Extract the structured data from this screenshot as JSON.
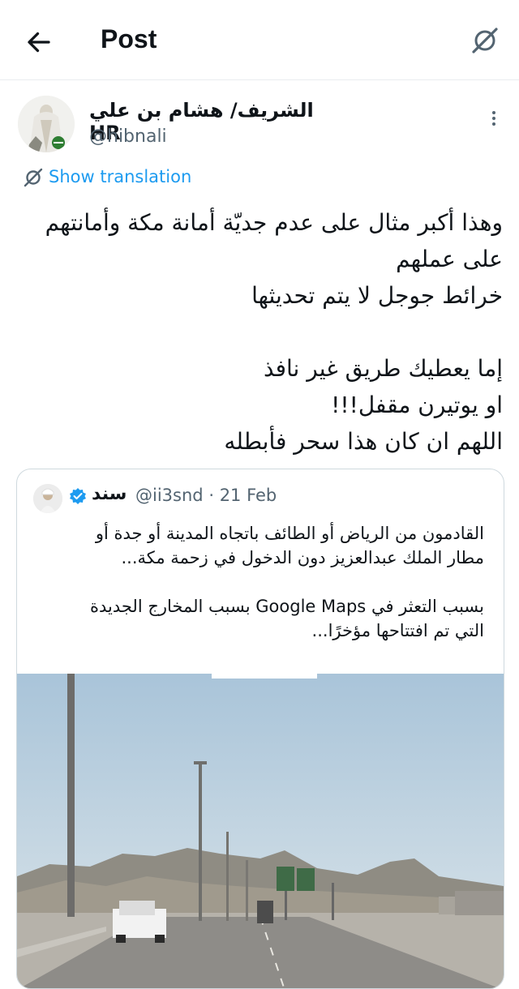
{
  "header": {
    "title": "Post",
    "back_icon": "arrow-left-icon",
    "grok_icon": "grok-icon"
  },
  "author": {
    "name": "الشريف/ هشام بن علي HR",
    "handle": "@hibnali",
    "more_icon": "more-vertical-icon"
  },
  "translation": {
    "label": "Show translation",
    "icon": "translate-icon"
  },
  "post": {
    "lines": [
      "وهذا أكبر مثال على عدم جديّة أمانة مكة وأمانتهم",
      "على عملهم",
      "خرائط جوجل لا يتم تحديثها",
      "",
      "إما يعطيك طريق غير نافذ",
      "او يوتيرن مقفل!!!",
      "اللهم ان كان هذا سحر فأبطله"
    ]
  },
  "quote": {
    "name": "سند",
    "handle": "@ii3snd",
    "separator": "·",
    "date": "21 Feb",
    "verified_icon": "verified-badge-icon",
    "lines": [
      "القادمون من الرياض أو الطائف باتجاه المدينة أو جدة أو",
      "مطار الملك عبدالعزيز دون الدخول في زحمة مكة...",
      "",
      "بسبب التعثر في Google Maps بسبب المخارج الجديدة",
      "التي تم افتتاحها مؤخرًا..."
    ]
  },
  "colors": {
    "link": "#1d9bf0",
    "secondary_text": "#536471",
    "border": "#cfd9de"
  }
}
